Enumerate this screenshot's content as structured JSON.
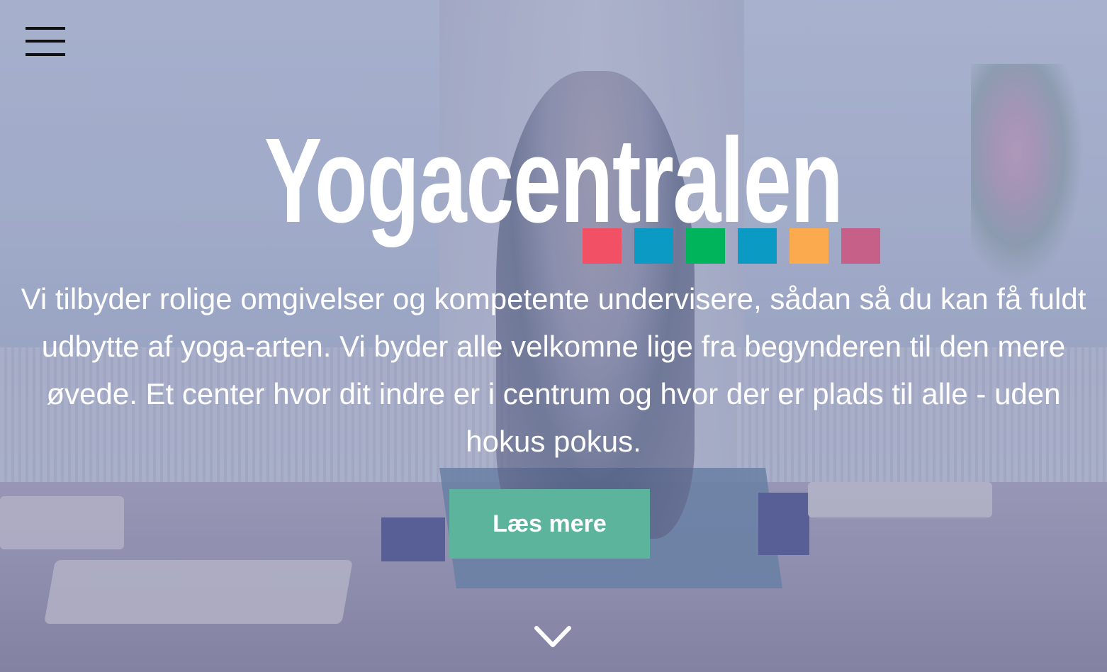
{
  "header": {
    "menu_icon": "hamburger-menu-icon"
  },
  "hero": {
    "title": "Yogacentralen",
    "logo_squares": [
      "#f25064",
      "#0b9ac4",
      "#00b45c",
      "#0b9ac4",
      "#fbab4e",
      "#c66089"
    ],
    "description": "Vi tilbyder rolige omgivelser og kompetente undervisere, sådan så du kan få fuldt udbytte af yoga-arten. Vi byder alle velkomne lige fra begynderen til den mere øvede. Et center hvor dit indre er i centrum og hvor der er plads til alle - uden hokus pokus.",
    "cta_label": "Læs mere",
    "cta_color": "#5db49c",
    "scroll_icon": "chevron-down-icon"
  },
  "colors": {
    "text": "#ffffff",
    "menu_icon": "#111111"
  }
}
